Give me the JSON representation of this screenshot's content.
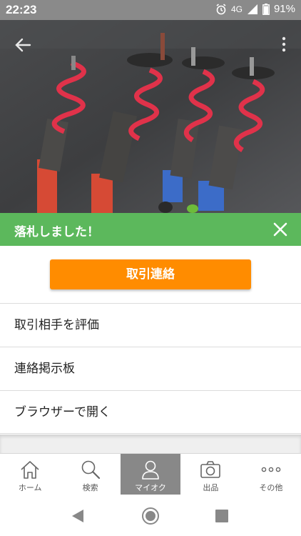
{
  "status_bar": {
    "time": "22:23",
    "network": "4G",
    "battery": "91%"
  },
  "banner": {
    "message": "落札しました！"
  },
  "actions": {
    "contact_label": "取引連絡"
  },
  "menu": {
    "items": [
      {
        "label": "取引相手を評価"
      },
      {
        "label": "連絡掲示板"
      },
      {
        "label": "ブラウザーで開く"
      }
    ]
  },
  "tab_bar": {
    "tabs": [
      {
        "label": "ホーム",
        "icon": "home-icon"
      },
      {
        "label": "検索",
        "icon": "search-icon"
      },
      {
        "label": "マイオク",
        "icon": "person-icon",
        "active": true
      },
      {
        "label": "出品",
        "icon": "camera-icon"
      },
      {
        "label": "その他",
        "icon": "more-dots-icon"
      }
    ]
  },
  "colors": {
    "banner": "#5cb85c",
    "primary_button": "#ff8c00",
    "active_tab": "#888888"
  }
}
